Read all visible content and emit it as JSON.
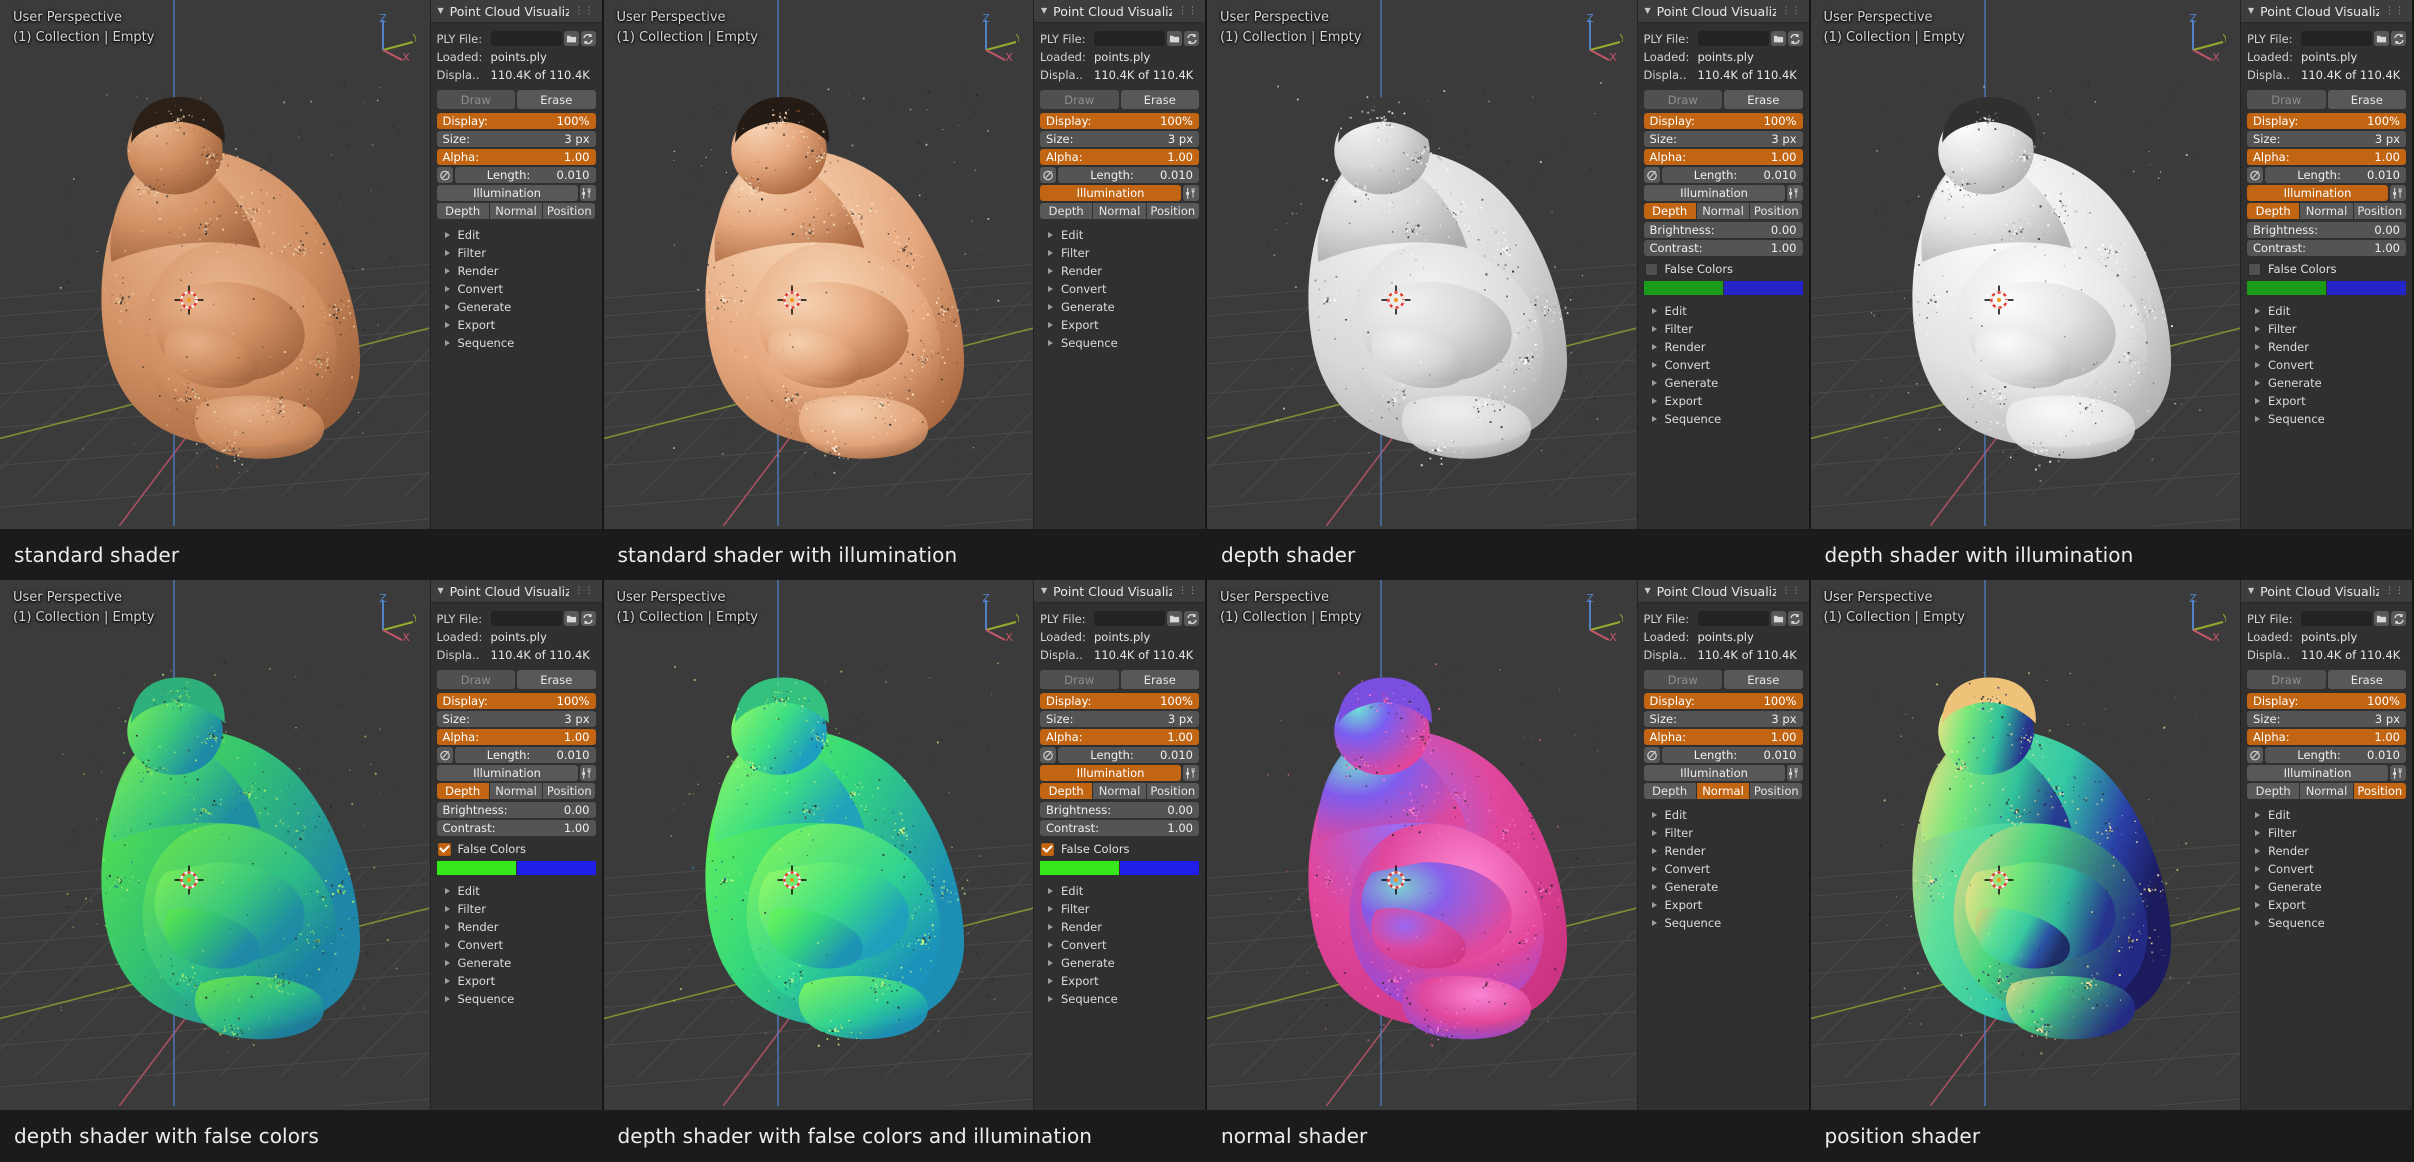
{
  "panel": {
    "title": "Point Cloud Visualizer",
    "grip_icon": "grip-dots-icon",
    "collapse_icon": "triangle-down-icon",
    "ply_label": "PLY File:",
    "ply_value": "",
    "open_icon": "folder-open-icon",
    "reload_icon": "refresh-icon",
    "loaded_label": "Loaded:",
    "loaded_value": "points.ply",
    "display_count_label": "Displa..",
    "display_count_value": "110.4K of 110.4K",
    "draw_label": "Draw",
    "erase_label": "Erase",
    "display_label": "Display:",
    "display_value": "100%",
    "size_label": "Size:",
    "size_value": "3 px",
    "alpha_label": "Alpha:",
    "alpha_value": "1.00",
    "length_icon": "normals-length-icon",
    "length_label": "Length:",
    "length_value": "0.010",
    "illumination_label": "Illumination",
    "illumination_settings_icon": "tool-settings-icon",
    "shader_modes": [
      "Depth",
      "Normal",
      "Position"
    ],
    "brightness_label": "Brightness:",
    "brightness_value": "0.00",
    "contrast_label": "Contrast:",
    "contrast_value": "1.00",
    "false_colors_label": "False Colors",
    "tree_items": [
      "Edit",
      "Filter",
      "Render",
      "Convert",
      "Generate",
      "Export",
      "Sequence"
    ]
  },
  "viewport": {
    "perspective_text": "User Perspective",
    "collection_text": "(1) Collection | Empty",
    "gizmo_axes": [
      "Z",
      "Y",
      "X"
    ],
    "cursor_icon": "3d-cursor-icon"
  },
  "colors": {
    "accent": "#c26512",
    "panel_bg": "#303030",
    "viewport_bg": "#3b3b3b",
    "caption_bg": "#1b1b1b",
    "axis_x": "#c2576a",
    "axis_y": "#93ac2f",
    "axis_z": "#4f82c6",
    "false_color_a_row1": "#1a9b1a",
    "false_color_b_row1": "#2424c8",
    "false_color_a_row2": "#36e81c",
    "false_color_b_row2": "#1f1fe8"
  },
  "cells": [
    {
      "id": "standard-shader",
      "caption": "standard shader",
      "illumination_on": false,
      "shader_mode": null,
      "show_brightness_contrast": false,
      "show_false_colors": false,
      "false_colors_checked": false,
      "figure": "skin"
    },
    {
      "id": "standard-shader-illumination",
      "caption": "standard shader with illumination",
      "illumination_on": true,
      "shader_mode": null,
      "show_brightness_contrast": false,
      "show_false_colors": false,
      "false_colors_checked": false,
      "figure": "skin-lit"
    },
    {
      "id": "depth-shader",
      "caption": "depth shader",
      "illumination_on": false,
      "shader_mode": "Depth",
      "show_brightness_contrast": true,
      "show_false_colors": true,
      "false_colors_checked": false,
      "figure": "grey"
    },
    {
      "id": "depth-shader-illumination",
      "caption": "depth shader with illumination",
      "illumination_on": true,
      "shader_mode": "Depth",
      "show_brightness_contrast": true,
      "show_false_colors": true,
      "false_colors_checked": false,
      "figure": "grey-lit"
    },
    {
      "id": "depth-shader-false-colors",
      "caption": "depth shader with false colors",
      "illumination_on": false,
      "shader_mode": "Depth",
      "show_brightness_contrast": true,
      "show_false_colors": true,
      "false_colors_checked": true,
      "figure": "falsecolor"
    },
    {
      "id": "depth-shader-false-colors-illumination",
      "caption": "depth shader with false colors and illumination",
      "illumination_on": true,
      "shader_mode": "Depth",
      "show_brightness_contrast": true,
      "show_false_colors": true,
      "false_colors_checked": true,
      "figure": "falsecolor-lit"
    },
    {
      "id": "normal-shader",
      "caption": "normal shader",
      "illumination_on": false,
      "shader_mode": "Normal",
      "show_brightness_contrast": false,
      "show_false_colors": false,
      "false_colors_checked": false,
      "figure": "normals"
    },
    {
      "id": "position-shader",
      "caption": "position shader",
      "illumination_on": false,
      "shader_mode": "Position",
      "show_brightness_contrast": false,
      "show_false_colors": false,
      "false_colors_checked": false,
      "figure": "position"
    }
  ]
}
